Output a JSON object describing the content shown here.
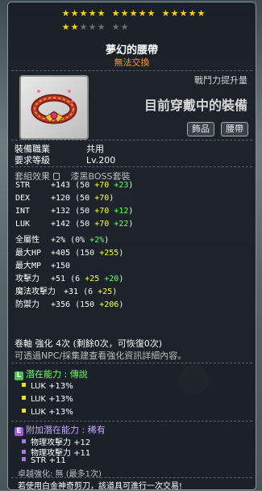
{
  "stars": {
    "filled": 17,
    "total": 22
  },
  "item": {
    "name": "夢幻的腰帶",
    "trade_status": "無法交換",
    "combat_power_label": "戰鬥力提升量",
    "equipped_label": "目前穿戴中的裝備",
    "tags": [
      "飾品",
      "腰帶"
    ],
    "job_label": "裝備職業",
    "job_value": "共用",
    "level_label": "要求等級",
    "level_value": "Lv.200",
    "set_label": "套組效果",
    "set_value": "漆黑BOSS套裝"
  },
  "stats": [
    {
      "name": "STR",
      "total": "+143",
      "base": "50",
      "bonus": "+70",
      "enh": "+23"
    },
    {
      "name": "DEX",
      "total": "+120",
      "base": "50",
      "bonus": "+70",
      "enh": ""
    },
    {
      "name": "INT",
      "total": "+132",
      "base": "50",
      "bonus": "+70",
      "enh": "+12"
    },
    {
      "name": "LUK",
      "total": "+142",
      "base": "50",
      "bonus": "+70",
      "enh": "+22"
    }
  ],
  "stats_tail": [
    {
      "name": "全屬性",
      "total": "+2%",
      "paren_open": "(0%",
      "bonus": "",
      "enh": "+2%",
      "type": "pct"
    },
    {
      "name": "最大HP",
      "total": "+405",
      "base": "150",
      "bonus": "+255",
      "enh": ""
    },
    {
      "name": "最大MP",
      "total": "+150",
      "base": "",
      "bonus": "",
      "enh": ""
    },
    {
      "name": "攻擊力",
      "total": "+51",
      "base": "6",
      "bonus": "+25",
      "enh": "+20"
    },
    {
      "name": "魔法攻擊力",
      "total": "+31",
      "base": "6",
      "bonus": "+25",
      "enh": ""
    },
    {
      "name": "防禦力",
      "total": "+356",
      "base": "150",
      "bonus": "+206",
      "enh": ""
    }
  ],
  "scroll_line": "卷軸 強化 4次 (剩餘0次，可恢復0次)",
  "npc_line": "可透過NPC/採集建查看強化資訊詳細內容。",
  "potential": {
    "title": "潛在能力 : 傳說",
    "badge": "L",
    "lines": [
      "LUK +13%",
      "LUK +13%",
      "LUK +13%"
    ]
  },
  "additional_potential": {
    "title": "附加潛在能力 : 稀有",
    "badge": "E",
    "lines": [
      "物理攻擊力 +12",
      "物理攻擊力 +11",
      "STR +11"
    ]
  },
  "transcend": "卓越強化: 無 (最多1次)",
  "footer": "若使用白金神奇剪刀，該道具可進行一次交易!",
  "colors": {
    "star": "#ffd21a",
    "trade": "#ff9a1a",
    "cyan": "#66ffff",
    "yellow": "#ffff33",
    "green": "#66ff66"
  }
}
